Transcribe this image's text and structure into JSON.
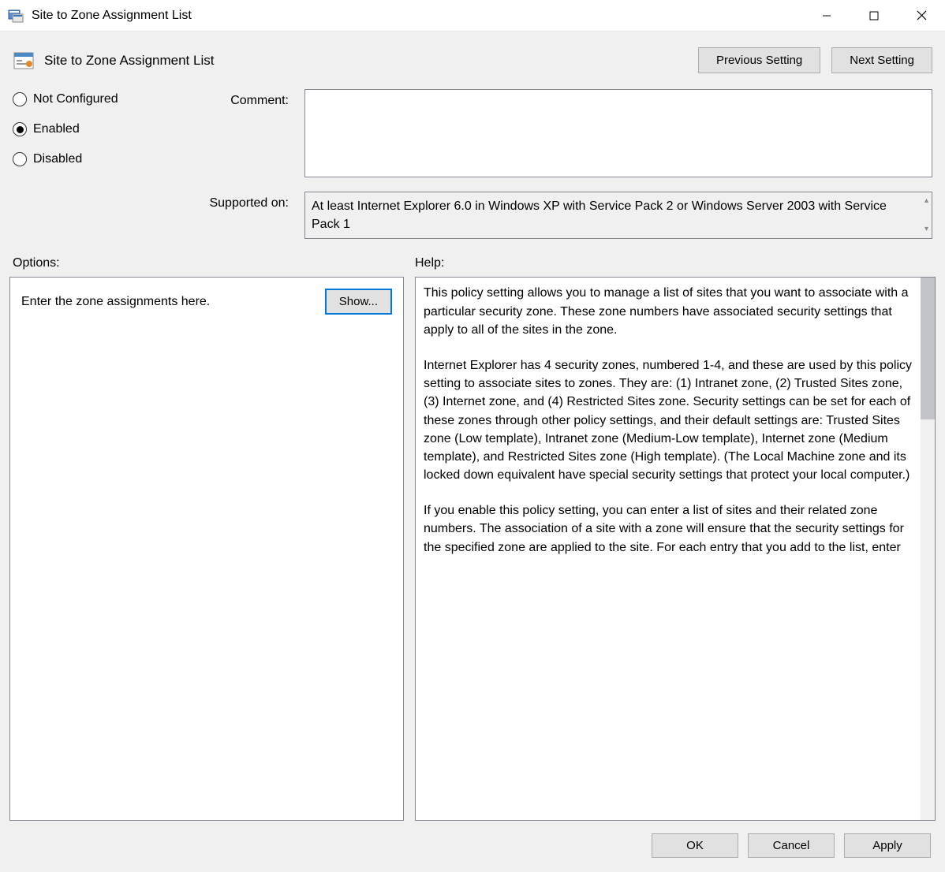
{
  "window": {
    "title": "Site to Zone Assignment List"
  },
  "header": {
    "title": "Site to Zone Assignment List",
    "previous_label": "Previous Setting",
    "next_label": "Next Setting"
  },
  "state": {
    "not_configured_label": "Not Configured",
    "enabled_label": "Enabled",
    "disabled_label": "Disabled",
    "selected": "enabled"
  },
  "comment": {
    "label": "Comment:",
    "value": ""
  },
  "supported": {
    "label": "Supported on:",
    "value": "At least Internet Explorer 6.0 in Windows XP with Service Pack 2 or Windows Server 2003 with Service Pack 1"
  },
  "sections": {
    "options_label": "Options:",
    "help_label": "Help:"
  },
  "options": {
    "prompt": "Enter the zone assignments here.",
    "show_button": "Show..."
  },
  "help": {
    "p1": "This policy setting allows you to manage a list of sites that you want to associate with a particular security zone. These zone numbers have associated security settings that apply to all of the sites in the zone.",
    "p2": "Internet Explorer has 4 security zones, numbered 1-4, and these are used by this policy setting to associate sites to zones. They are: (1) Intranet zone, (2) Trusted Sites zone, (3) Internet zone, and (4) Restricted Sites zone. Security settings can be set for each of these zones through other policy settings, and their default settings are: Trusted Sites zone (Low template), Intranet zone (Medium-Low template), Internet zone (Medium template), and Restricted Sites zone (High template). (The Local Machine zone and its locked down equivalent have special security settings that protect your local computer.)",
    "p3": "If you enable this policy setting, you can enter a list of sites and their related zone numbers. The association of a site with a zone will ensure that the security settings for the specified zone are applied to the site. For each entry that you add to the list, enter"
  },
  "footer": {
    "ok": "OK",
    "cancel": "Cancel",
    "apply": "Apply"
  }
}
